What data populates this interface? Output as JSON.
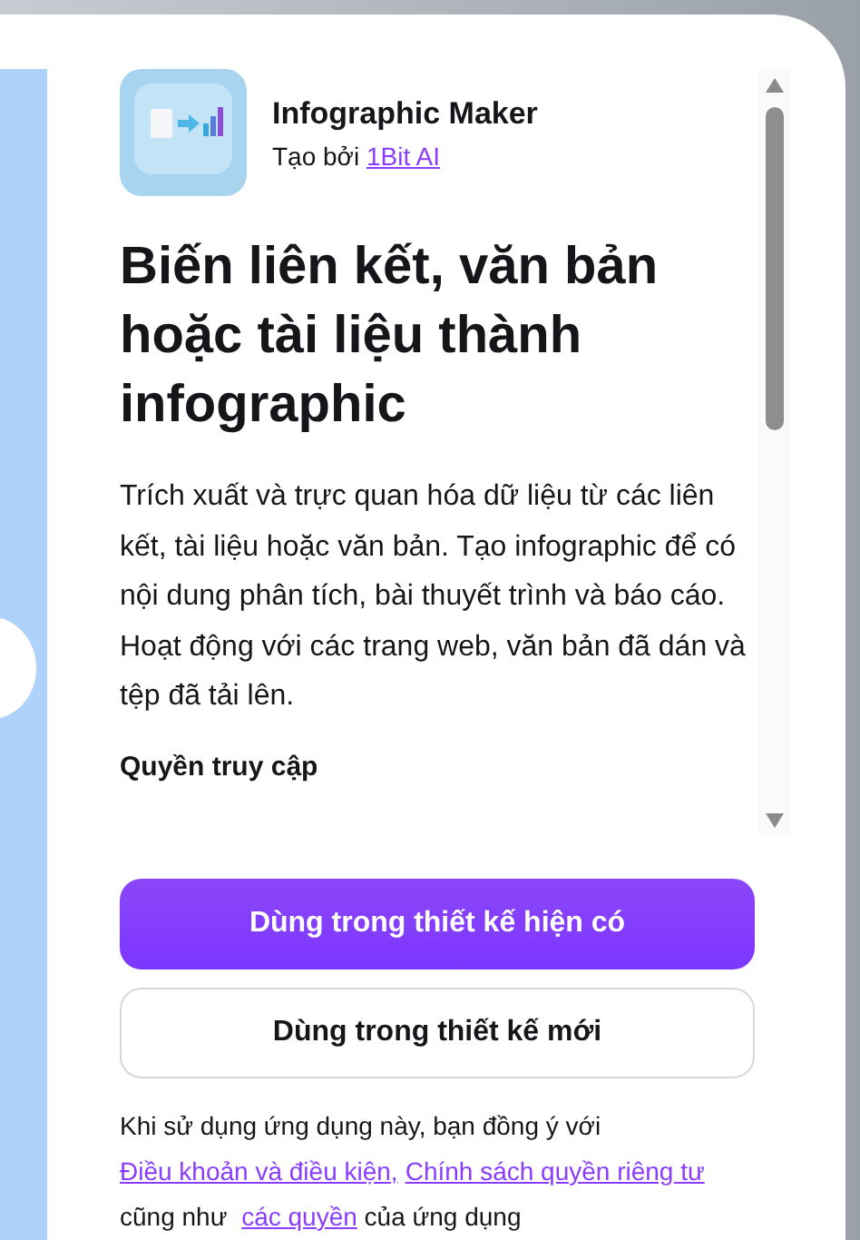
{
  "app": {
    "name": "Infographic Maker",
    "byline": "Tạo bởi",
    "author": "1Bit AI"
  },
  "title": "Biến liên kết, văn bản hoặc tài liệu thành infographic",
  "description": "Trích xuất và trực quan hóa dữ liệu từ các liên kết, tài liệu hoặc văn bản. Tạo infographic để có nội dung phân tích, bài thuyết trình và báo cáo. Hoạt động với các trang web, văn bản đã dán và tệp đã tải lên.",
  "section_heading": "Quyền truy cập",
  "buttons": [
    {
      "label": "Dùng trong thiết kế hiện có",
      "kind": "primary"
    },
    {
      "label": "Dùng trong thiết kế mới",
      "kind": "secondary"
    }
  ],
  "footer": [
    {
      "text": "Khi sử dụng ứng dụng này, bạn đồng ý với ",
      "kind": "text"
    },
    {
      "text": "Điều khoản và điều kiện,",
      "kind": "link"
    },
    {
      "text": "Chính sách quyền riêng tư",
      "kind": "link"
    },
    {
      "text": " cũng như ",
      "kind": "text"
    },
    {
      "text": "các quyền",
      "kind": "link"
    },
    {
      "text": " của ứng dụng",
      "kind": "text"
    }
  ]
}
